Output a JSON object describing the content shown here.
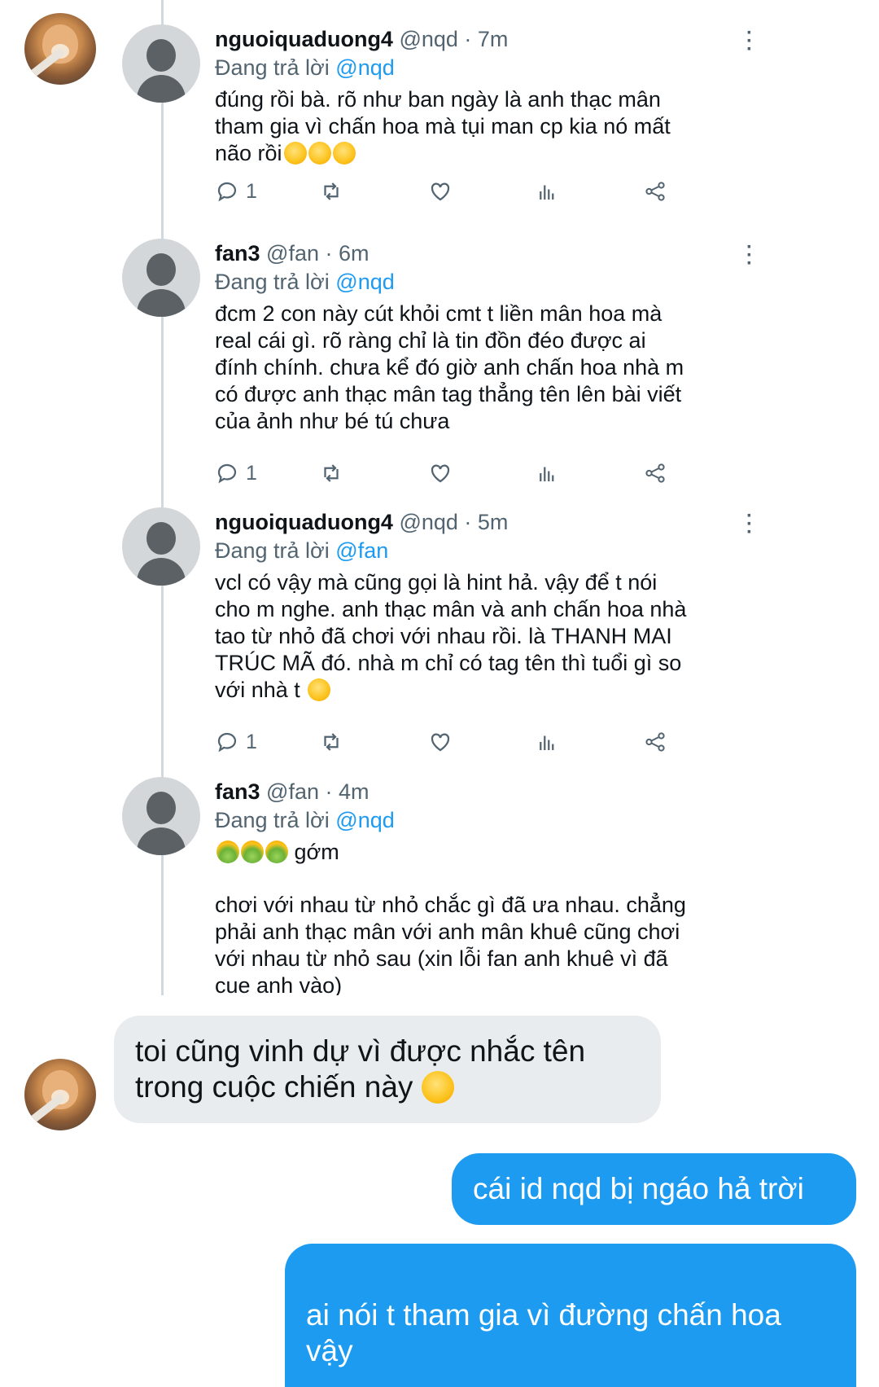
{
  "thread": {
    "tweets": [
      {
        "name": "nguoiquaduong4",
        "meta": "@nqd · 7m",
        "reply_prefix": "Đang trả lời",
        "reply_mention": "@nqd",
        "text": "đúng rồi bà. rõ như ban ngày là anh thạc mân\ntham gia vì chấn hoa mà tụi man cp kia nó mất\nnão rồi",
        "emoji": "rolling-on-floor-laughing x3",
        "reply_count": "1"
      },
      {
        "name": "fan3",
        "meta": "@fan · 6m",
        "reply_prefix": "Đang trả lời",
        "reply_mention": "@nqd",
        "text": "đcm 2 con này cút khỏi cmt t liền mân hoa mà\nreal cái gì. rõ ràng chỉ là tin đồn đéo được ai\nđính chính. chưa kể đó giờ anh chấn hoa nhà m\ncó được anh thạc mân tag thẳng tên lên bài viết\ncủa ảnh như bé tú chưa",
        "reply_count": "1"
      },
      {
        "name": "nguoiquaduong4",
        "meta": "@nqd · 5m",
        "reply_prefix": "Đang trả lời",
        "reply_mention": "@fan",
        "text": "vcl có vậy mà cũng gọi là hint hả. vậy để t nói\ncho m nghe. anh thạc mân và anh chấn hoa nhà\ntao từ nhỏ đã chơi với nhau rồi. là THANH MAI\nTRÚC MÃ đó. nhà m chỉ có tag tên thì tuổi gì so\nvới nhà t",
        "emoji": "smirking-face",
        "reply_count": "1"
      },
      {
        "name": "fan3",
        "meta": "@fan · 4m",
        "reply_prefix": "Đang trả lời",
        "reply_mention": "@nqd",
        "text_first": "gớm",
        "emoji": "nauseated-face x3",
        "text": "chơi với nhau từ nhỏ chắc gì đã ưa nhau. chẳng\nphải anh thạc mân với anh mân khuê cũng chơi\nvới nhau từ nhỏ sau (xin lỗi fan anh khuê vì đã\ncue anh vào)"
      }
    ]
  },
  "messages": {
    "received": "toi cũng vinh dự vì được nhắc tên\ntrong cuộc chiến này",
    "received_emoji": "winking-face",
    "sent_1": "cái id nqd bị ngáo hả trời",
    "sent_2": "ai nói t tham gia vì đường chấn hoa\nvậy"
  },
  "colors": {
    "accent": "#1d9bf0",
    "muted": "#536471",
    "received_bubble": "#e9ecef"
  }
}
